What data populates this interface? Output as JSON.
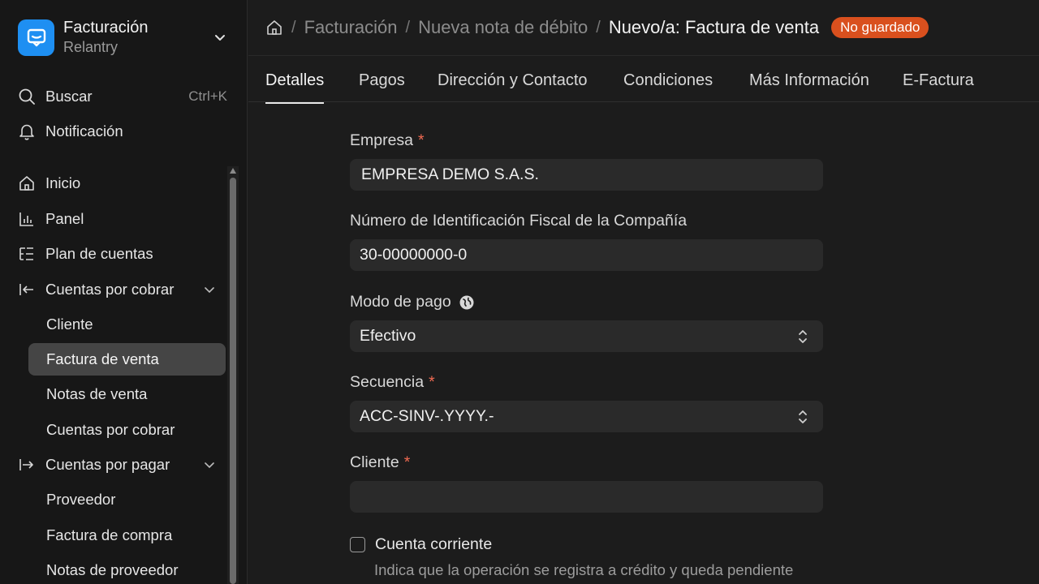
{
  "brand": {
    "title": "Facturación",
    "subtitle": "Relantry"
  },
  "sidebar": {
    "search": {
      "label": "Buscar",
      "shortcut": "Ctrl+K"
    },
    "notifications": {
      "label": "Notificación"
    },
    "items": [
      {
        "label": "Inicio"
      },
      {
        "label": "Panel"
      },
      {
        "label": "Plan de cuentas"
      },
      {
        "label": "Cuentas por cobrar"
      },
      {
        "label": "Cliente"
      },
      {
        "label": "Factura de venta"
      },
      {
        "label": "Notas de venta"
      },
      {
        "label": "Cuentas por cobrar"
      },
      {
        "label": "Cuentas por pagar"
      },
      {
        "label": "Proveedor"
      },
      {
        "label": "Factura de compra"
      },
      {
        "label": "Notas de proveedor"
      }
    ]
  },
  "breadcrumb": {
    "items": [
      "Facturación",
      "Nueva nota de débito",
      "Nuevo/a: Factura de venta"
    ],
    "separator": "/",
    "status_badge": "No guardado"
  },
  "tabs": [
    "Detalles",
    "Pagos",
    "Dirección y Contacto",
    "Condiciones",
    "Más Información",
    "E-Factura"
  ],
  "form": {
    "company": {
      "label": "Empresa",
      "required": "*",
      "value": "EMPRESA DEMO S.A.S."
    },
    "tax_id": {
      "label": "Número de Identificación Fiscal de la Compañía",
      "value": "30-00000000-0"
    },
    "payment_mode": {
      "label": "Modo de pago",
      "value": "Efectivo"
    },
    "sequence": {
      "label": "Secuencia",
      "required": "*",
      "value": "ACC-SINV-.YYYY.-"
    },
    "customer": {
      "label": "Cliente",
      "required": "*",
      "value": ""
    },
    "current_account": {
      "label": "Cuenta corriente",
      "help": "Indica que la operación se registra a crédito y queda pendiente"
    }
  },
  "colors": {
    "accent": "#1e8ff2",
    "badge": "#d9501e",
    "required": "#ef6a52",
    "active_item": "#454545"
  }
}
